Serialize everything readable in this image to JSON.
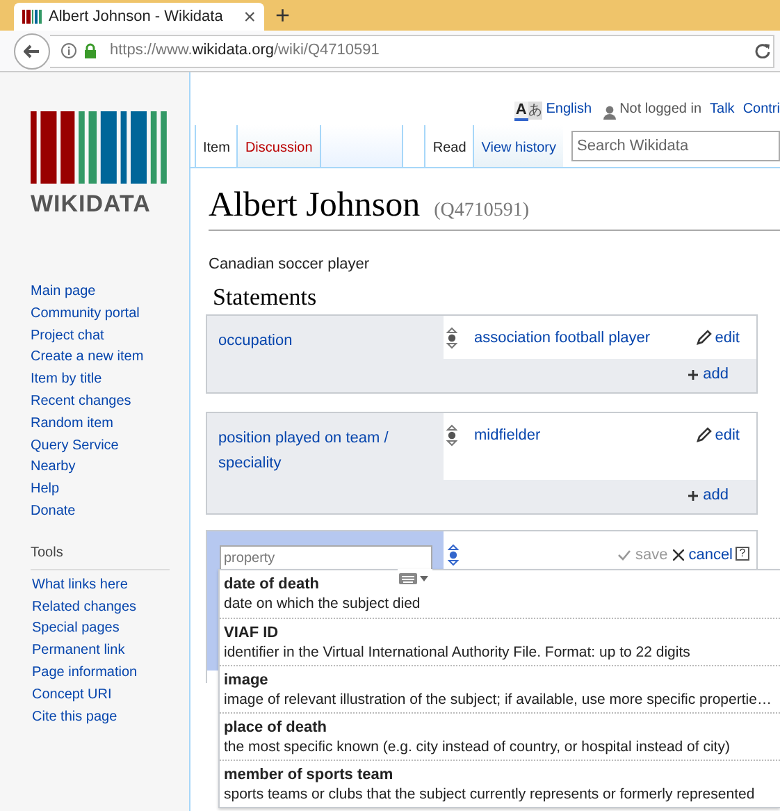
{
  "browser": {
    "tab_title": "Albert Johnson - Wikidata",
    "close": "×",
    "new_tab": "+",
    "url": {
      "scheme": "https://www.",
      "host": "wikidata.org",
      "path": "/wiki/Q4710591"
    }
  },
  "personal": {
    "language_icon": [
      "A",
      "あ"
    ],
    "language": "English",
    "user_status": "Not logged in",
    "links": [
      "Talk",
      "Contri"
    ]
  },
  "tabs_left": [
    {
      "label": "Item",
      "selected": true,
      "exists": true
    },
    {
      "label": "Discussion",
      "selected": false,
      "exists": false
    }
  ],
  "tabs_right": [
    {
      "label": "Read",
      "selected": true
    },
    {
      "label": "View history",
      "selected": false
    }
  ],
  "search": {
    "placeholder": "Search Wikidata"
  },
  "logo": {
    "wordmark": "WIKIDATA"
  },
  "sidebar": {
    "navigation": [
      "Main page",
      "Community portal",
      "Project chat",
      "Create a new item",
      "Item by title",
      "Recent changes",
      "Random item",
      "Query Service",
      "Nearby",
      "Help",
      "Donate"
    ],
    "tools_heading": "Tools",
    "tools": [
      "What links here",
      "Related changes",
      "Special pages",
      "Permanent link",
      "Page information",
      "Concept URI",
      "Cite this page"
    ]
  },
  "title": "Albert Johnson",
  "item_id": "(Q4710591)",
  "description": "Canadian soccer player",
  "statements_heading": "Statements",
  "statements": [
    {
      "property": "occupation",
      "value": "association football player",
      "edit": "edit",
      "add": "add"
    },
    {
      "property": "position played on team / speciality",
      "value": "midfielder",
      "edit": "edit",
      "add": "add"
    }
  ],
  "new_statement": {
    "placeholder": "property",
    "save": "save",
    "cancel": "cancel",
    "help": "?",
    "suggestions": [
      {
        "label": "date of death",
        "description": "date on which the subject died"
      },
      {
        "label": "VIAF ID",
        "description": "identifier in the Virtual International Authority File. Format: up to 22 digits"
      },
      {
        "label": "image",
        "description": "image of relevant illustration of the subject; if available, use more specific propertie…"
      },
      {
        "label": "place of death",
        "description": "the most specific known (e.g. city instead of country, or hospital instead of city)"
      },
      {
        "label": "member of sports team",
        "description": "sports teams or clubs that the subject currently represents or formerly represented"
      }
    ]
  }
}
